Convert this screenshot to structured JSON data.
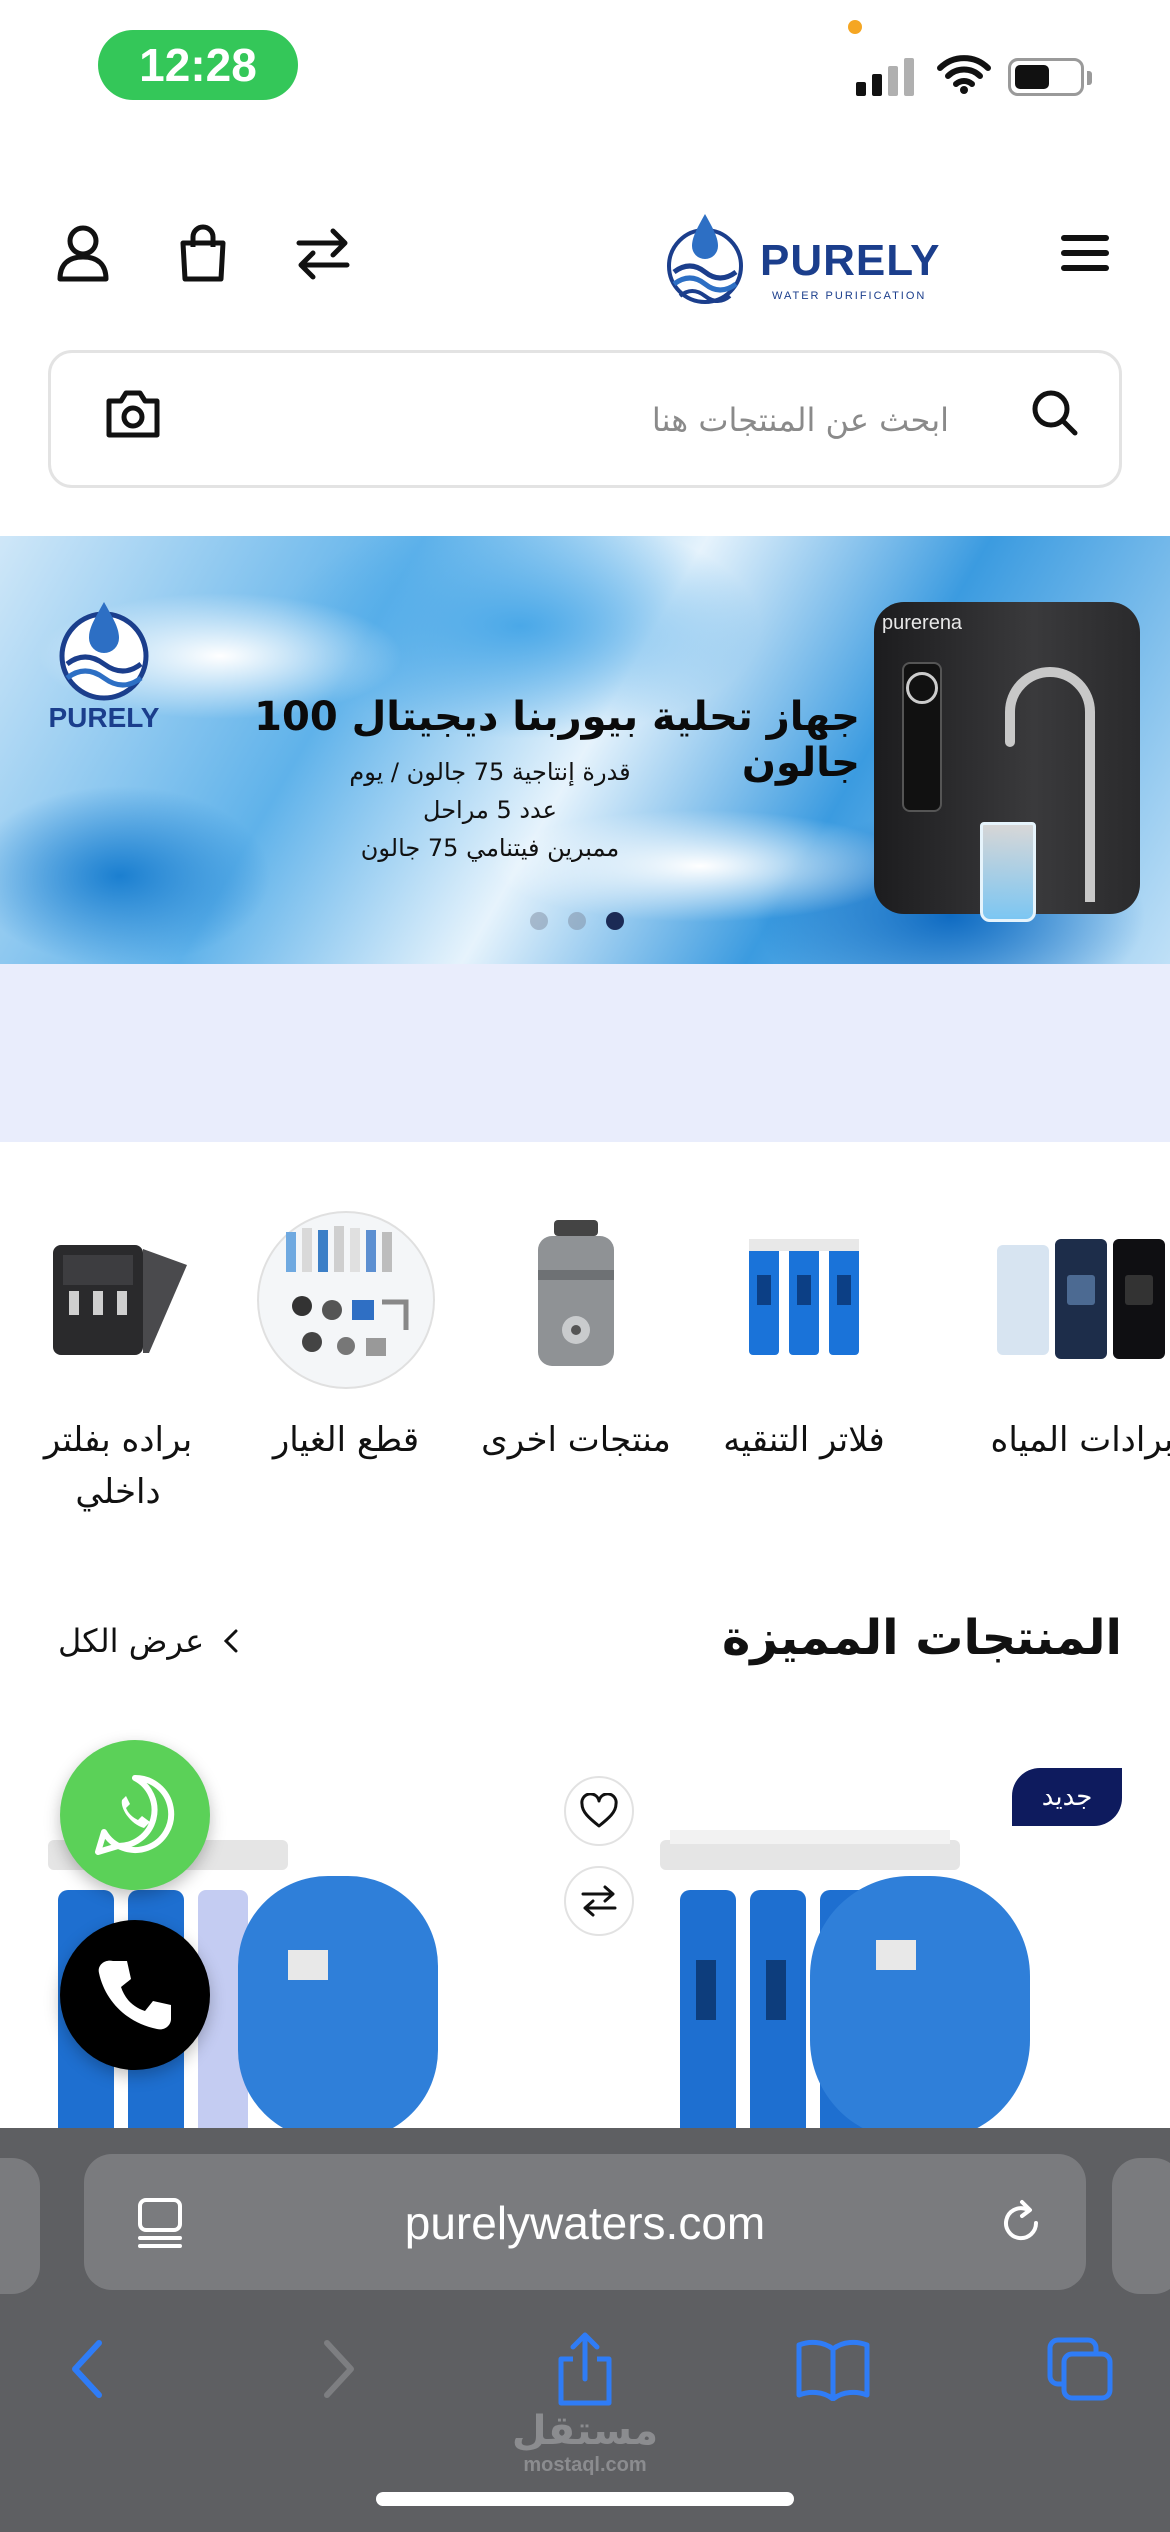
{
  "status_bar": {
    "time": "12:28"
  },
  "header": {
    "logo_text": "PURELY",
    "logo_subtext": "WATER PURIFICATION",
    "icons": [
      "account-icon",
      "cart-icon",
      "compare-icon",
      "menu-icon"
    ]
  },
  "search": {
    "placeholder": "ابحث عن المنتجات هنا"
  },
  "banner": {
    "logo_text": "PURELY",
    "title": "جهاز تحلية بيوربنا ديجيتال 100 جالون",
    "lines": [
      "قدرة إنتاجية 75 جالون / يوم",
      "عدد 5 مراحل",
      "ممبرين فيتنامي 75 جالون"
    ],
    "device_brand": "purerena",
    "slides_total": 3,
    "active_slide": 3
  },
  "categories": [
    {
      "label": "برادات المياه"
    },
    {
      "label": "فلاتر التنقيه"
    },
    {
      "label": "منتجات اخرى"
    },
    {
      "label": "قطع الغيار"
    },
    {
      "label": "براده بفلتر داخلي"
    }
  ],
  "featured": {
    "title": "المنتجات المميزة",
    "view_all": "عرض الكل",
    "badge_new": "جديد"
  },
  "safari": {
    "url": "purelywaters.com",
    "watermark_ar": "مستقل",
    "watermark_en": "mostaql.com"
  },
  "colors": {
    "time_pill": "#34c759",
    "brand_navy": "#1b3e8c",
    "badge": "#0e1b5e",
    "whatsapp": "#5bd158",
    "lavender_strip": "#e9edfc",
    "safari_bar": "#5e5f62",
    "safari_accent": "#2f7cf6"
  }
}
